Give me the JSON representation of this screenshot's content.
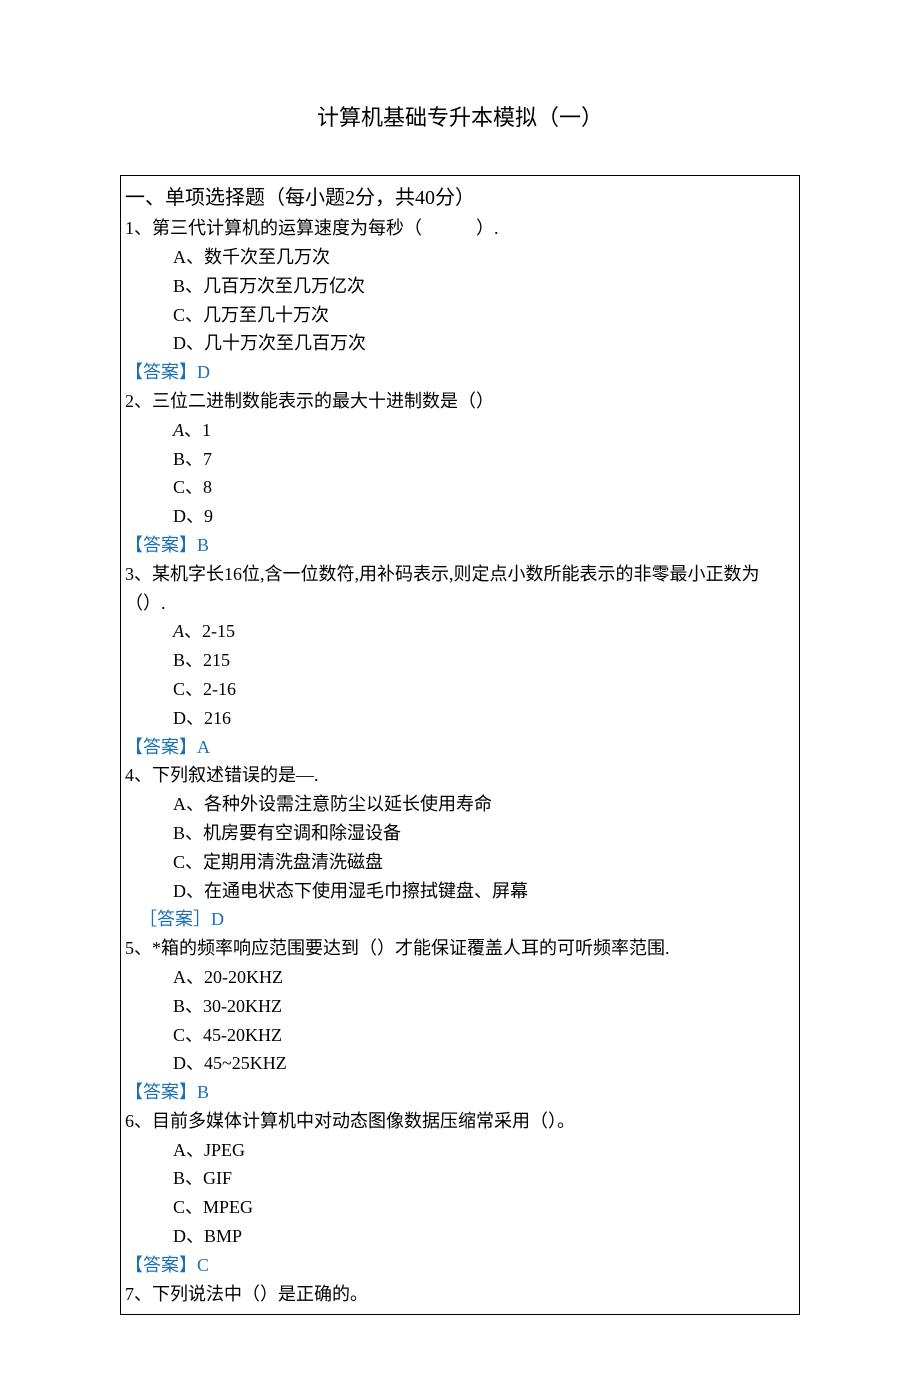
{
  "title": "计算机基础专升本模拟（一）",
  "section_header": "一、单项选择题（每小题2分，共40分）",
  "questions": [
    {
      "stem": "1、第三代计算机的运算速度为每秒（　　　）.",
      "options": [
        "A、数千次至几万次",
        "B、几百万次至几万亿次",
        "C、几万至几十万次",
        "D、几十万次至几百万次"
      ],
      "answer": "【答案】D"
    },
    {
      "stem": "2、三位二进制数能表示的最大十进制数是（）",
      "options": [
        "A、1",
        "B、7",
        "C、8",
        "D、9"
      ],
      "answer": "【答案】B",
      "italic_first_label": true
    },
    {
      "stem": "3、某机字长16位,含一位数符,用补码表示,则定点小数所能表示的非零最小正数为（）.",
      "options": [
        "A、2-15",
        "B、215",
        "C、2-16",
        "D、216"
      ],
      "answer": "【答案】A",
      "italic_first_label": true
    },
    {
      "stem": "4、下列叙述错误的是—.",
      "options": [
        "A、各种外设需注意防尘以延长使用寿命",
        "B、机房要有空调和除湿设备",
        "C、定期用清洗盘清洗磁盘",
        "D、在通电状态下使用湿毛巾擦拭键盘、屏幕"
      ],
      "answer": "［答案］D",
      "answer_indent": true
    },
    {
      "stem": "5、*箱的频率响应范围要达到（）才能保证覆盖人耳的可听频率范围.",
      "options": [
        "A、20-20KHZ",
        "B、30-20KHZ",
        "C、45-20KHZ",
        "D、45~25KHZ"
      ],
      "answer": "【答案】B"
    },
    {
      "stem": "6、目前多媒体计算机中对动态图像数据压缩常采用（）。",
      "options": [
        "A、JPEG",
        "B、GIF",
        "C、MPEG",
        "D、BMP"
      ],
      "answer": "【答案】C"
    },
    {
      "stem": "7、下列说法中（）是正确的。"
    }
  ]
}
